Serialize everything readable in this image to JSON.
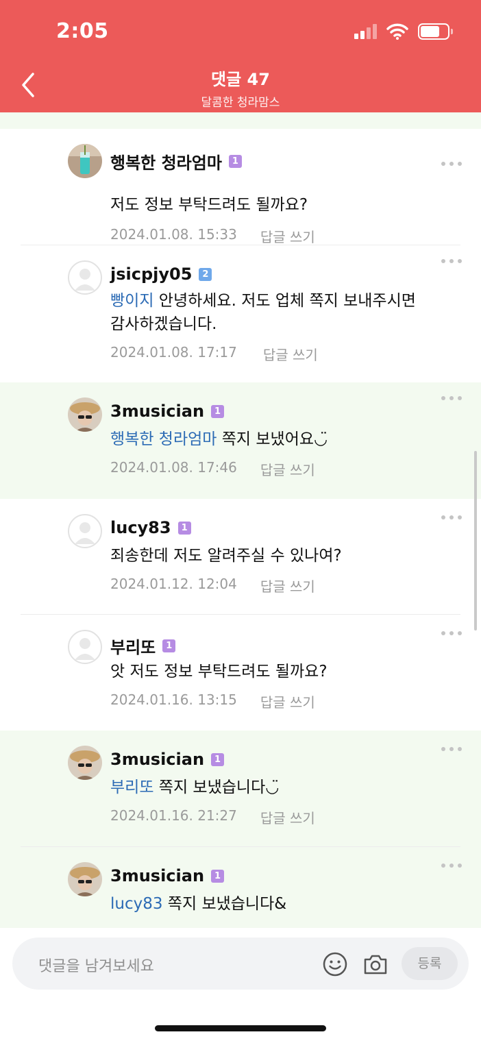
{
  "status_bar": {
    "time": "2:05"
  },
  "header": {
    "title": "댓글 47",
    "subtitle": "달콤한 청라맘스"
  },
  "comments": [
    {
      "author": "행복한 청라엄마",
      "level": "1",
      "mention": "",
      "text": "저도 정보 부탁드려도 될까요?",
      "date": "2024.01.08. 15:33",
      "reply_label": "답글 쓰기"
    },
    {
      "author": "jsicpjy05",
      "level": "2",
      "mention": "빵이지",
      "text": " 안녕하세요. 저도 업체 쪽지 보내주시면 감사하겠습니다.",
      "date": "2024.01.08. 17:17",
      "reply_label": "답글 쓰기"
    },
    {
      "author": "3musician",
      "level": "1",
      "mention": "행복한 청라엄마",
      "text": " 쪽지 보냈어요◡̈",
      "date": "2024.01.08. 17:46",
      "reply_label": "답글 쓰기"
    },
    {
      "author": "lucy83",
      "level": "1",
      "mention": "",
      "text": "죄송한데 저도 알려주실 수 있나여?",
      "date": "2024.01.12. 12:04",
      "reply_label": "답글 쓰기"
    },
    {
      "author": "부리또",
      "level": "1",
      "mention": "",
      "text": "앗 저도 정보 부탁드려도 될까요?",
      "date": "2024.01.16. 13:15",
      "reply_label": "답글 쓰기"
    },
    {
      "author": "3musician",
      "level": "1",
      "mention": "부리또",
      "text": " 쪽지 보냈습니다◡̈",
      "date": "2024.01.16. 21:27",
      "reply_label": "답글 쓰기"
    },
    {
      "author": "3musician",
      "level": "1",
      "mention": "lucy83",
      "text": " 쪽지 보냈습니다&",
      "date": "",
      "reply_label": ""
    }
  ],
  "input_bar": {
    "placeholder": "댓글을 남겨보세요",
    "submit_label": "등록"
  },
  "colors": {
    "header": "#ec5a59",
    "reply_bg": "#f3faf0",
    "mention": "#2c6bb5",
    "level1": "#b68ce3",
    "level2": "#6fa8ea"
  }
}
